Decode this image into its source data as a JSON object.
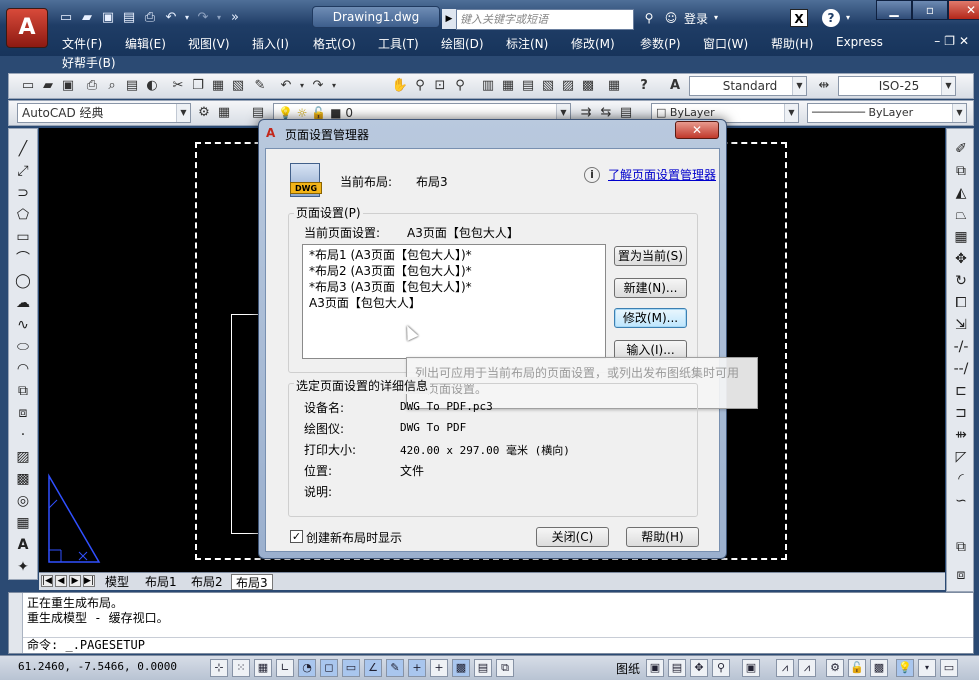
{
  "app": {
    "logo_letter": "A",
    "document_tab": "Drawing1.dwg",
    "search_placeholder": "键入关键字或短语",
    "login_label": "登录",
    "help_label": "?",
    "window_controls": {
      "minimize": "▁",
      "restore": "▫",
      "close": "✕"
    }
  },
  "menu": {
    "items": [
      "文件(F)",
      "编辑(E)",
      "视图(V)",
      "插入(I)",
      "格式(O)",
      "工具(T)",
      "绘图(D)",
      "标注(N)",
      "修改(M)",
      "参数(P)",
      "窗口(W)",
      "帮助(H)",
      "Express"
    ],
    "second_row": "好帮手(B)"
  },
  "toolbar": {
    "text_style": "Standard",
    "dim_style": "ISO-25",
    "workspace": "AutoCAD 经典",
    "layer_value": "0",
    "color": "ByLayer",
    "linetype": "ByLayer"
  },
  "layout_tabs": [
    "模型",
    "布局1",
    "布局2",
    "布局3"
  ],
  "active_layout_tab": "布局3",
  "command_line": {
    "history": [
      "正在重生成布局。",
      "重生成模型 - 缓存视口。"
    ],
    "prompt_label": "命令:",
    "prompt_value": "_.PAGESETUP"
  },
  "status_bar": {
    "coordinates": "61.2460, -7.5466, 0.0000",
    "paper_label": "图纸"
  },
  "dialog": {
    "title": "页面设置管理器",
    "icon_tag": "DWG",
    "current_layout_label": "当前布局:",
    "current_layout_value": "布局3",
    "help_link": "了解页面设置管理器",
    "page_setup_group": "页面设置(P)",
    "current_setup_label": "当前页面设置:",
    "current_setup_value": "A3页面【包包大人】",
    "setups": [
      "*布局1 (A3页面【包包大人】)*",
      "*布局2 (A3页面【包包大人】)*",
      "*布局3 (A3页面【包包大人】)*",
      "A3页面【包包大人】"
    ],
    "buttons": {
      "set_current": "置为当前(S)",
      "new": "新建(N)...",
      "modify": "修改(M)...",
      "import": "输入(I)...",
      "close": "关闭(C)",
      "help": "帮助(H)"
    },
    "tooltip": "列出可应用于当前布局的页面设置，或列出发布图纸集时可用的页面设置。",
    "details_group": "选定页面设置的详细信息",
    "details": [
      {
        "label": "设备名:",
        "value": "DWG To PDF.pc3"
      },
      {
        "label": "绘图仪:",
        "value": "DWG To PDF"
      },
      {
        "label": "打印大小:",
        "value": "420.00 x 297.00 毫米 (横向)"
      },
      {
        "label": "位置:",
        "value": "文件"
      },
      {
        "label": "说明:",
        "value": ""
      }
    ],
    "checkbox_label": "创建新布局时显示",
    "checkbox_checked": true
  }
}
